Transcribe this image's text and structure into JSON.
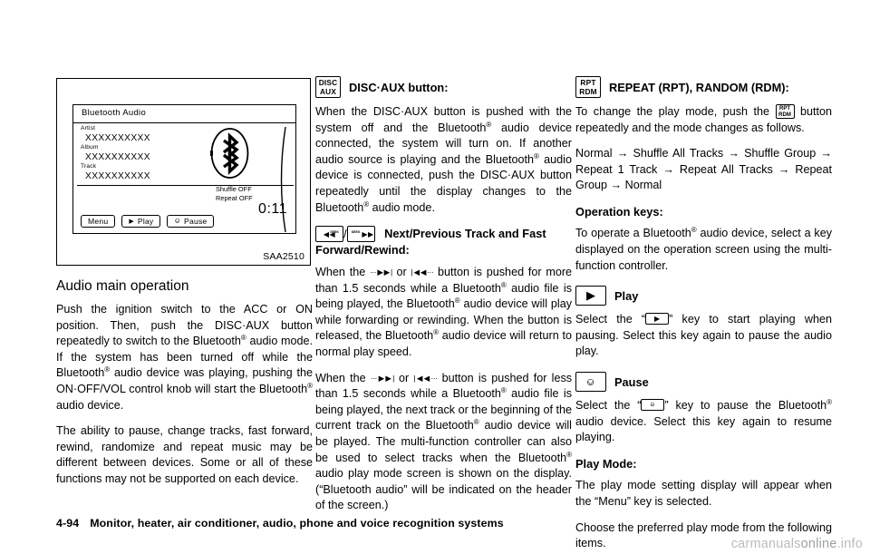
{
  "figure": {
    "caption": "SAA2510",
    "screen": {
      "header": "Bluetooth Audio",
      "fields": [
        {
          "label": "Artist",
          "value": "XXXXXXXXXX"
        },
        {
          "label": "Album",
          "value": "XXXXXXXXXX"
        },
        {
          "label": "Track",
          "value": "XXXXXXXXXX"
        }
      ],
      "shuffle_status": "Shuffle OFF",
      "repeat_status": "Repeat OFF",
      "elapsed_time": "0:11",
      "softkeys": [
        {
          "name": "menu",
          "label": "Menu",
          "glyph": ""
        },
        {
          "name": "play",
          "label": "Play",
          "glyph": "▶"
        },
        {
          "name": "pause",
          "label": "Pause",
          "glyph": "⎉"
        }
      ]
    }
  },
  "column1": {
    "section_title": "Audio main operation",
    "paragraph_1_a": "Push the ignition switch to the ACC or ON position. Then, push the DISC·AUX button repeatedly to switch to the Bluetooth",
    "paragraph_1_b": " audio mode. If the system has been turned off while the Bluetooth",
    "paragraph_1_c": " audio device was playing, pushing the ON·OFF/VOL control knob will start the Bluetooth",
    "paragraph_1_d": " audio device.",
    "paragraph_2": "The ability to pause, change tracks, fast forward, rewind, randomize and repeat music may be different between devices. Some or all of these functions may not be supported on each device."
  },
  "column2": {
    "disc_aux_icon": {
      "line1": "DISC",
      "line2": "AUX"
    },
    "disc_aux_title": "DISC·AUX button:",
    "disc_aux_body_a": "When the DISC·AUX button is pushed with the system off and the Bluetooth",
    "disc_aux_body_b": " audio device connected, the system will turn on. If another audio source is playing and the Bluetooth",
    "disc_aux_body_c": " audio device is connected, push the DISC·AUX button repeatedly until the display changes to the Bluetooth",
    "disc_aux_body_d": " audio mode.",
    "track_icon_seek_label": "SEEK",
    "track_title_line1": "Next/Previous Track and Fast",
    "track_title_line2": "Forward/Rewind:",
    "track_p1_a": "When the",
    "track_p1_fwd": "···▶▶|",
    "track_p1_b": "or",
    "track_p1_rew": "|◀◀···",
    "track_p1_c": "button is pushed for more than 1.5 seconds while a Bluetooth",
    "track_p1_d": " audio file is being played, the Bluetooth",
    "track_p1_e": " audio device will play while forwarding or rewinding. When the button is released, the Bluetooth",
    "track_p1_f": " audio device will return to normal play speed.",
    "track_p2_c": "button is pushed for less than 1.5 seconds while a Bluetooth",
    "track_p2_d": " audio file is being played, the next track or the beginning of the current track on the Bluetooth",
    "track_p2_e": " audio device will be played. The multi-function controller can also be used to select tracks when the Bluetooth",
    "track_p2_f": " audio play mode screen is shown on the display. (“Bluetooth audio” will be indicated on the header of the screen.)"
  },
  "column3": {
    "rpt_icon": {
      "line1": "RPT",
      "line2": "RDM"
    },
    "rpt_title": "REPEAT (RPT), RANDOM (RDM):",
    "rpt_body_a": "To change the play mode, push the",
    "rpt_body_b": "button repeatedly and the mode changes as follows.",
    "mode_sequence": "Normal → Shuffle All Tracks → Shuffle Group → Repeat 1 Track → Repeat All Tracks → Repeat Group → Normal",
    "operation_keys_title": "Operation keys:",
    "operation_keys_body_a": "To operate a Bluetooth",
    "operation_keys_body_b": " audio device, select a key displayed on the operation screen using the multi-function controller.",
    "play_glyph": "▶",
    "play_title": "Play",
    "play_body_a": "Select the “",
    "play_body_b": "” key to start playing when pausing. Select this key again to pause the audio play.",
    "pause_glyph": "⎉",
    "pause_title": "Pause",
    "pause_body_a": "Select the “",
    "pause_body_b": "” key to pause the Bluetooth",
    "pause_body_c": " audio device. Select this key again to resume playing.",
    "play_mode_title": "Play Mode:",
    "play_mode_body_1": "The play mode setting display will appear when the “Menu” key is selected.",
    "play_mode_body_2": "Choose the preferred play mode from the following items."
  },
  "footer": {
    "page_number": "4-94",
    "chapter_title": "Monitor, heater, air conditioner, audio, phone and voice recognition systems"
  },
  "watermark": {
    "text_light": "carmanuals",
    "text_dark": "online",
    "suffix": ".info"
  }
}
